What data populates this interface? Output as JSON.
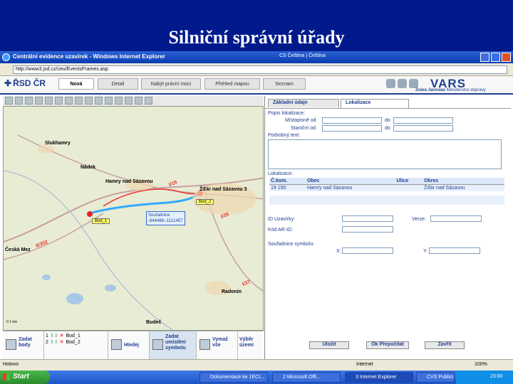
{
  "slide": {
    "title": "Silniční správní úřady"
  },
  "window": {
    "title": "Centrální evidence uzavírek - Windows Internet Explorer",
    "toolbar_text": "CS Čeština  |  Čeština",
    "address": "http://www3.jsd.cz/ceu/EventsFrames.asp"
  },
  "app": {
    "brand": "ŘSD ČR",
    "tabs": [
      "Nová",
      "Detail",
      "Nabýt právní moci",
      "Přehled mapou",
      "Seznam"
    ],
    "vars_logo": "VARS",
    "user_name": "Zvára Jaroslav",
    "user_org": "Ministerstvo dopravy"
  },
  "map": {
    "places": [
      "Slukhamry",
      "Nádek",
      "Hamry nad Sázavou",
      "Žďár nad Sázavou 3",
      "Česká Mez",
      "Radonín",
      "Budeč"
    ],
    "roads": [
      "I/19",
      "II/352",
      "I/37",
      "I/35"
    ],
    "points": [
      "Bod_1",
      "Bod_2"
    ],
    "coord_title": "Souřadnice",
    "coord_value": "-644488;-1121457",
    "scale": "0 1 km"
  },
  "bottom_tools": {
    "add_points": "Zadat body",
    "points_list": [
      {
        "num": "1",
        "name": "Bod_1"
      },
      {
        "num": "2",
        "name": "Bod_2"
      }
    ],
    "find": "Hledej",
    "add_symbols": "Zadat umístění symbolu",
    "delete_all": "Vymaž vše",
    "select_area": "Výběr území"
  },
  "panel": {
    "tabs": [
      "Základní údaje",
      "Lokalizace"
    ],
    "location_desc": "Popis lokalizace:",
    "place_from": "Místopisně od",
    "station_from": "Staniční od",
    "to": "do",
    "detail_text": "Podrobný text:",
    "localization": "Lokalizace:",
    "columns": [
      "Č.kom.",
      "Obec",
      "Ulice",
      "Okres"
    ],
    "rows": [
      [
        "19 150",
        "Hamry nad Sázavou",
        "",
        "Žďár nad Sázavou"
      ]
    ],
    "id_closure": "ID Uzavírky:",
    "version": "Verze:",
    "kod_ruian": "Kód AR-ID:",
    "symbol_coords": "Souřadnice symbolu:",
    "x_label": "X:",
    "y_label": "Y:",
    "btn_save": "Uložit",
    "btn_refresh": "Ok Přepočítat",
    "btn_close": "Zavřít"
  },
  "status": {
    "left": "Hotovo",
    "zone": "Internet",
    "zoom": "100%"
  },
  "taskbar": {
    "start": "Start",
    "tasks": [
      "Dokumentace ke 1ECI...",
      "2 Microsoft Offi...",
      "3 Internet Explorer",
      "CVS Publico..."
    ],
    "clock": "23:00"
  }
}
